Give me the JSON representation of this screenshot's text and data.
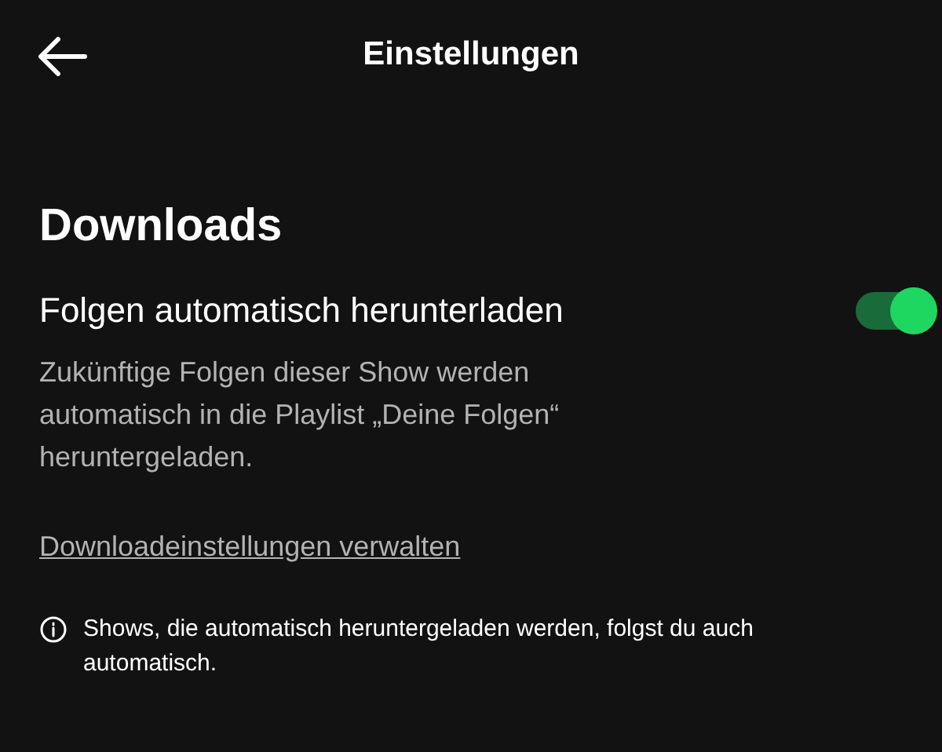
{
  "header": {
    "title": "Einstellungen"
  },
  "section": {
    "title": "Downloads"
  },
  "setting": {
    "label": "Folgen automatisch herunterladen",
    "on": true,
    "description": "Zukünftige Folgen dieser Show werden automatisch in die Playlist „Deine Folgen“ heruntergeladen."
  },
  "link": "Downloadeinstellungen verwalten",
  "info": "Shows, die automatisch heruntergeladen werden, folgst du auch automatisch."
}
